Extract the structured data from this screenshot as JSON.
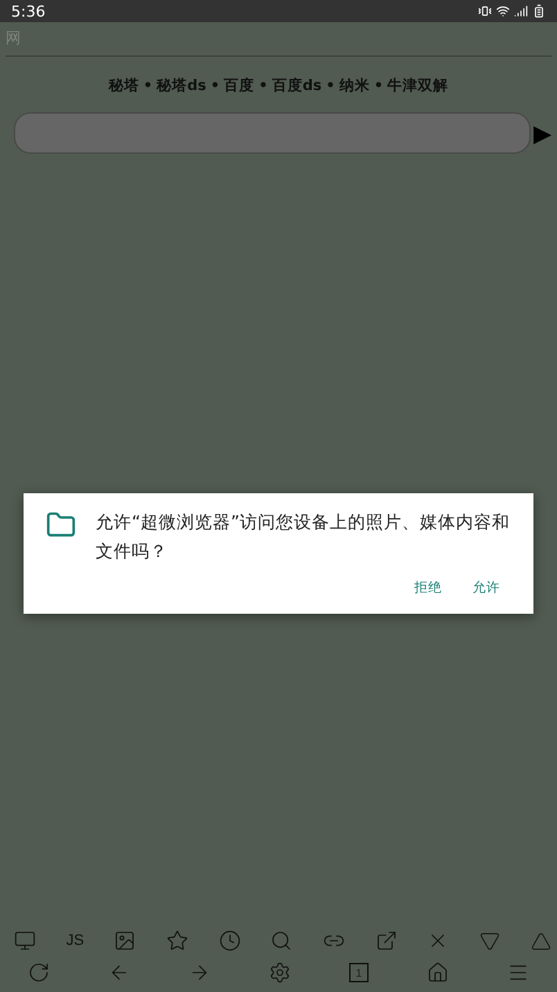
{
  "status_bar": {
    "time": "5:36"
  },
  "address_bar": {
    "placeholder": "网"
  },
  "quick_links": {
    "separator": "•",
    "items": [
      "秘塔",
      "秘塔ds",
      "百度",
      "百度ds",
      "纳米",
      "牛津双解"
    ]
  },
  "search": {
    "submit": "▶"
  },
  "dialog": {
    "message": "允许“超微浏览器”访问您设备上的照片、媒体内容和文件吗？",
    "buttons": [
      "拒绝",
      "允许"
    ]
  },
  "toolbar_top": [
    {
      "kind": "icon"
    },
    {
      "kind": "text",
      "label": "JS"
    },
    {
      "kind": "icon"
    },
    {
      "kind": "icon"
    },
    {
      "kind": "icon"
    },
    {
      "kind": "icon"
    },
    {
      "kind": "icon"
    },
    {
      "kind": "icon"
    },
    {
      "kind": "icon"
    },
    {
      "kind": "icon"
    },
    {
      "kind": "icon"
    }
  ],
  "toolbar_bottom": [
    {
      "kind": "icon"
    },
    {
      "kind": "icon"
    },
    {
      "kind": "icon"
    },
    {
      "kind": "icon"
    },
    {
      "kind": "tabs",
      "label": "1"
    },
    {
      "kind": "icon"
    },
    {
      "kind": "icon"
    }
  ]
}
